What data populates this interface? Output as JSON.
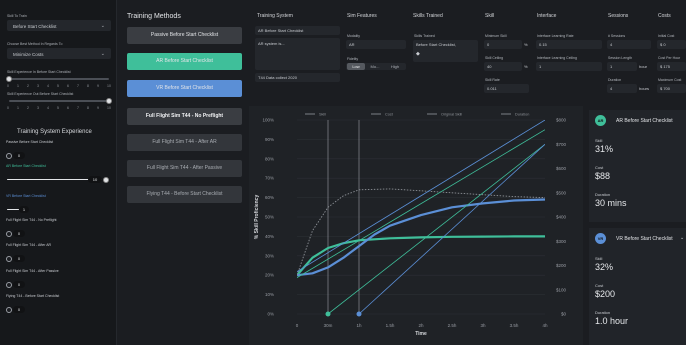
{
  "left": {
    "skill_to_train_label": "Skill To Train",
    "skill_to_train_value": "Before Start Checklist",
    "choose_best_label": "Choose Best Method In Regards To",
    "choose_best_value": "Minimize Costs",
    "exp_before_label": "Skill Experience In Before Start Checklist",
    "exp_out_label": "Skill Experience Out Before Start Checklist",
    "tick_labels": [
      "0",
      "1",
      "2",
      "3",
      "4",
      "5",
      "6",
      "7",
      "8",
      "9",
      "10"
    ],
    "exp_before_value": 0,
    "exp_out_value": 10,
    "section_title": "Training System Experience",
    "systems": [
      {
        "label": "Passive Before Start Checklist",
        "value": "0",
        "color": "#ffffff"
      },
      {
        "label": "AR Before Start Checklist",
        "value": "10",
        "color": "#3fbf9a"
      },
      {
        "label": "VR Before Start Checklist",
        "value": "1",
        "color": "#5b8fd6"
      },
      {
        "label": "Full Flight Sim T44 - No Preflight",
        "value": "0",
        "color": "#ffffff"
      },
      {
        "label": "Full Flight Sim T44 - After AR",
        "value": "0",
        "color": "#ffffff"
      },
      {
        "label": "Full Flight Sim T44 - After Passive",
        "value": "0",
        "color": "#ffffff"
      },
      {
        "label": "Flying T44 - Before Start Checklist",
        "value": "0",
        "color": "#ffffff"
      }
    ]
  },
  "methods": {
    "title": "Training Methods",
    "items": [
      "Passive Before Start Checklist",
      "AR Before Start Checklist",
      "VR Before Start Checklist",
      "Full Flight Sim T44 - No Preflight",
      "Full Flight Sim T44 - After AR",
      "Full Flight Sim T44 - After Passive",
      "Flying T44 - Before Start Checklist"
    ]
  },
  "table": {
    "headers": [
      "Training System",
      "Sim Features",
      "Skills Trained",
      "Skill",
      "Interface",
      "Sessions",
      "Costs"
    ],
    "training_system": {
      "name": "AR Before Start Checklist",
      "desc": "AR system is...",
      "data": "T44 Data collect 2020"
    },
    "sim": {
      "modality_label": "Modality",
      "modality": "AR",
      "fidelity_label": "Fidelity",
      "fidelity_opts": [
        "Low",
        "Mo...",
        "High"
      ]
    },
    "skills": {
      "label": "Skills Trained",
      "value": "Before Start Checklist,",
      "icon": "diamond-icon"
    },
    "skill": {
      "min_label": "Minimum Skill",
      "min": "0",
      "min_unit": "%",
      "ceil_label": "Skill Ceiling",
      "ceil": "40",
      "ceil_unit": "%",
      "rate_label": "Skill Rate",
      "rate": "0.011"
    },
    "interface": {
      "learn_label": "Interface Learning Rate",
      "learn": "0.15",
      "ceil_label": "Interface Learning Ceiling",
      "ceil": "1"
    },
    "sessions": {
      "num_label": "# Sessions",
      "num": "4",
      "len_label": "Session Length",
      "len": "1",
      "len_unit": "hour",
      "dur_label": "Duration",
      "dur": "4",
      "dur_unit": "hours"
    },
    "costs": {
      "init_label": "Initial Cost",
      "init": "$ 0",
      "per_label": "Cost Per Hour",
      "per": "$ 175",
      "max_label": "Maximum Cost",
      "max": "$ 700"
    }
  },
  "legend": [
    "Skill",
    "Cost",
    "Original Skill",
    "Duration"
  ],
  "chart_data": {
    "type": "line",
    "xlabel": "Time",
    "ylabel": "% Skill Proficiency",
    "x_ticks": [
      "0",
      "30m",
      "1h",
      "1.5h",
      "2h",
      "2.5h",
      "3h",
      "3.5h",
      "4h"
    ],
    "y_ticks": [
      "0%",
      "10%",
      "20%",
      "30%",
      "40%",
      "50%",
      "60%",
      "70%",
      "80%",
      "90%",
      "100%"
    ],
    "y2_ticks": [
      "$0",
      "$100",
      "$200",
      "$300",
      "$400",
      "$500",
      "$600",
      "$700",
      "$800"
    ],
    "xlim": [
      0,
      4
    ],
    "ylim": [
      0,
      100
    ],
    "y2lim": [
      0,
      800
    ],
    "series": [
      {
        "color": "#3fbf9a",
        "x": [
          0,
          0.25,
          0.5,
          0.75,
          1,
          1.5,
          2,
          2.5,
          3,
          3.5,
          4
        ],
        "y": [
          20,
          29,
          34,
          36.5,
          38,
          39,
          39.5,
          39.8,
          39.9,
          40,
          40
        ]
      },
      {
        "color": "#5b8fd6",
        "x": [
          0,
          0.25,
          0.5,
          0.75,
          1,
          1.25,
          1.5,
          2,
          2.5,
          3,
          3.5,
          4
        ],
        "y": [
          20,
          21,
          24,
          29,
          35,
          41,
          45.5,
          51,
          55,
          57,
          58.5,
          59
        ]
      },
      {
        "color": "#8d9197",
        "dashed": true,
        "x": [
          0,
          0.25,
          0.5,
          0.75,
          1,
          1.5,
          2,
          2.5,
          3,
          3.5,
          4
        ],
        "y": [
          20,
          43,
          55,
          61,
          64,
          64.5,
          63.5,
          62.5,
          61.5,
          60.5,
          60
        ]
      },
      {
        "color": "#3fbf9a",
        "axis": "cost",
        "x": [
          0.5,
          4
        ],
        "y": [
          0,
          700
        ]
      },
      {
        "color": "#5b8fd6",
        "axis": "cost",
        "x": [
          1,
          4
        ],
        "y": [
          0,
          700
        ]
      },
      {
        "color": "#5b8fd6",
        "axis": "cost",
        "x": [
          0,
          4
        ],
        "y": [
          175,
          800
        ]
      },
      {
        "color": "#3fbf9a",
        "axis": "cost",
        "x": [
          0,
          4
        ],
        "y": [
          150,
          760
        ]
      }
    ],
    "vlines": [
      {
        "x": 0.5,
        "color": "#3fbf9a"
      },
      {
        "x": 1,
        "color": "#5b8fd6"
      }
    ]
  },
  "cards": [
    {
      "badge": "AR",
      "badge_color": "#3fbf9a",
      "title": "AR Before Start Checklist",
      "chevron": "",
      "skill_label": "Skill",
      "skill": "31%",
      "cost_label": "Cost",
      "cost": "$88",
      "dur_label": "Duration",
      "dur": "30 mins"
    },
    {
      "badge": "VR",
      "badge_color": "#5b8fd6",
      "title": "VR Before Start Checklist",
      "chevron": "⌄",
      "skill_label": "Skill",
      "skill": "32%",
      "cost_label": "Cost",
      "cost": "$200",
      "dur_label": "Duration",
      "dur": "1.0 hour"
    }
  ]
}
